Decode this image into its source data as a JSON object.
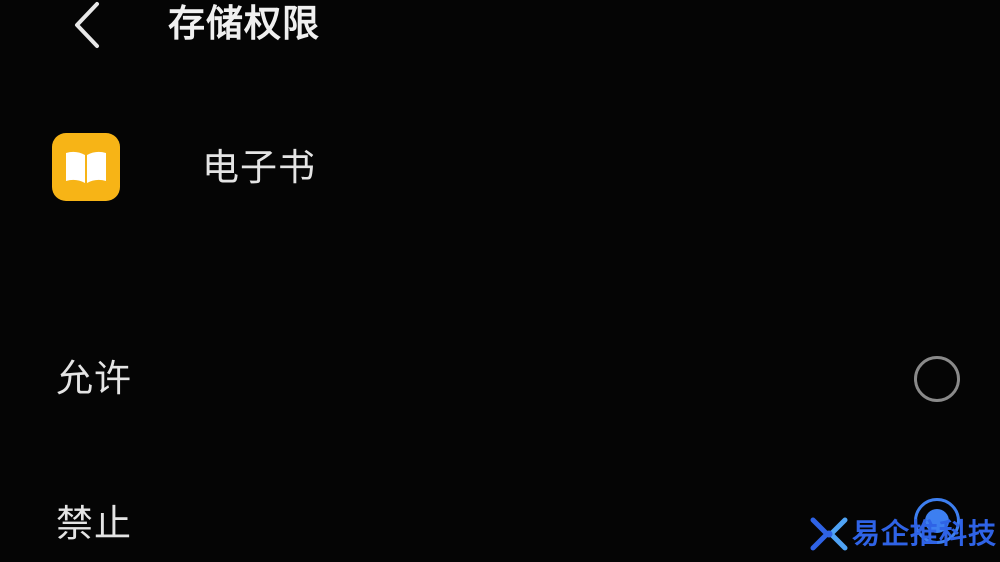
{
  "header": {
    "back_icon": "chevron-left-icon",
    "title": "存储权限"
  },
  "app": {
    "icon": "book-icon",
    "icon_color": "#f7b416",
    "name": "电子书"
  },
  "options": [
    {
      "label": "允许",
      "selected": false
    },
    {
      "label": "禁止",
      "selected": true
    }
  ],
  "accent_color": "#3d7ff0",
  "watermark": {
    "logo": "x-logo-icon",
    "text": "易企推科技"
  }
}
